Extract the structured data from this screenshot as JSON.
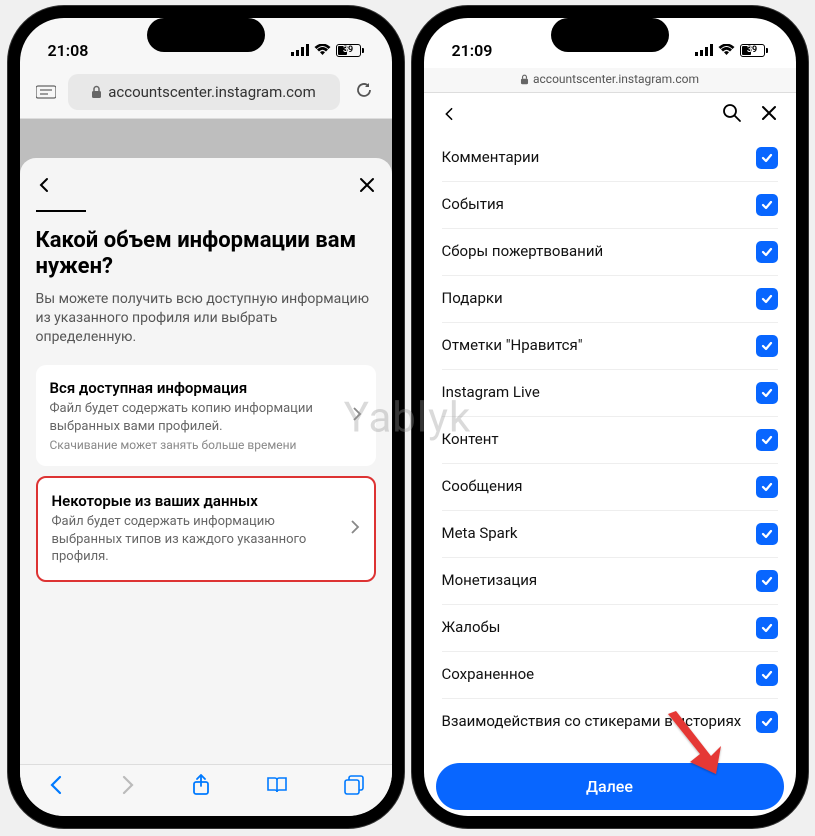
{
  "left": {
    "time": "21:08",
    "battery": "39",
    "url": "accountscenter.instagram.com",
    "modal": {
      "title": "Какой объем информации вам нужен?",
      "subtitle": "Вы можете получить всю доступную информацию из указанного профиля или выбрать определенную.",
      "option1": {
        "title": "Вся доступная информация",
        "desc": "Файл будет содержать копию информации выбранных вами профилей.",
        "note": "Скачивание может занять больше времени"
      },
      "option2": {
        "title": "Некоторые из ваших данных",
        "desc": "Файл будет содержать информацию выбранных типов из каждого указанного профиля."
      }
    }
  },
  "right": {
    "time": "21:09",
    "battery": "39",
    "url": "accountscenter.instagram.com",
    "categories": [
      "Комментарии",
      "События",
      "Сборы пожертвований",
      "Подарки",
      "Отметки \"Нравится\"",
      "Instagram Live",
      "Контент",
      "Сообщения",
      "Meta Spark",
      "Монетизация",
      "Жалобы",
      "Сохраненное",
      "Взаимодействия со стикерами в историях"
    ],
    "next": "Далее"
  },
  "watermark": "Yablyk"
}
